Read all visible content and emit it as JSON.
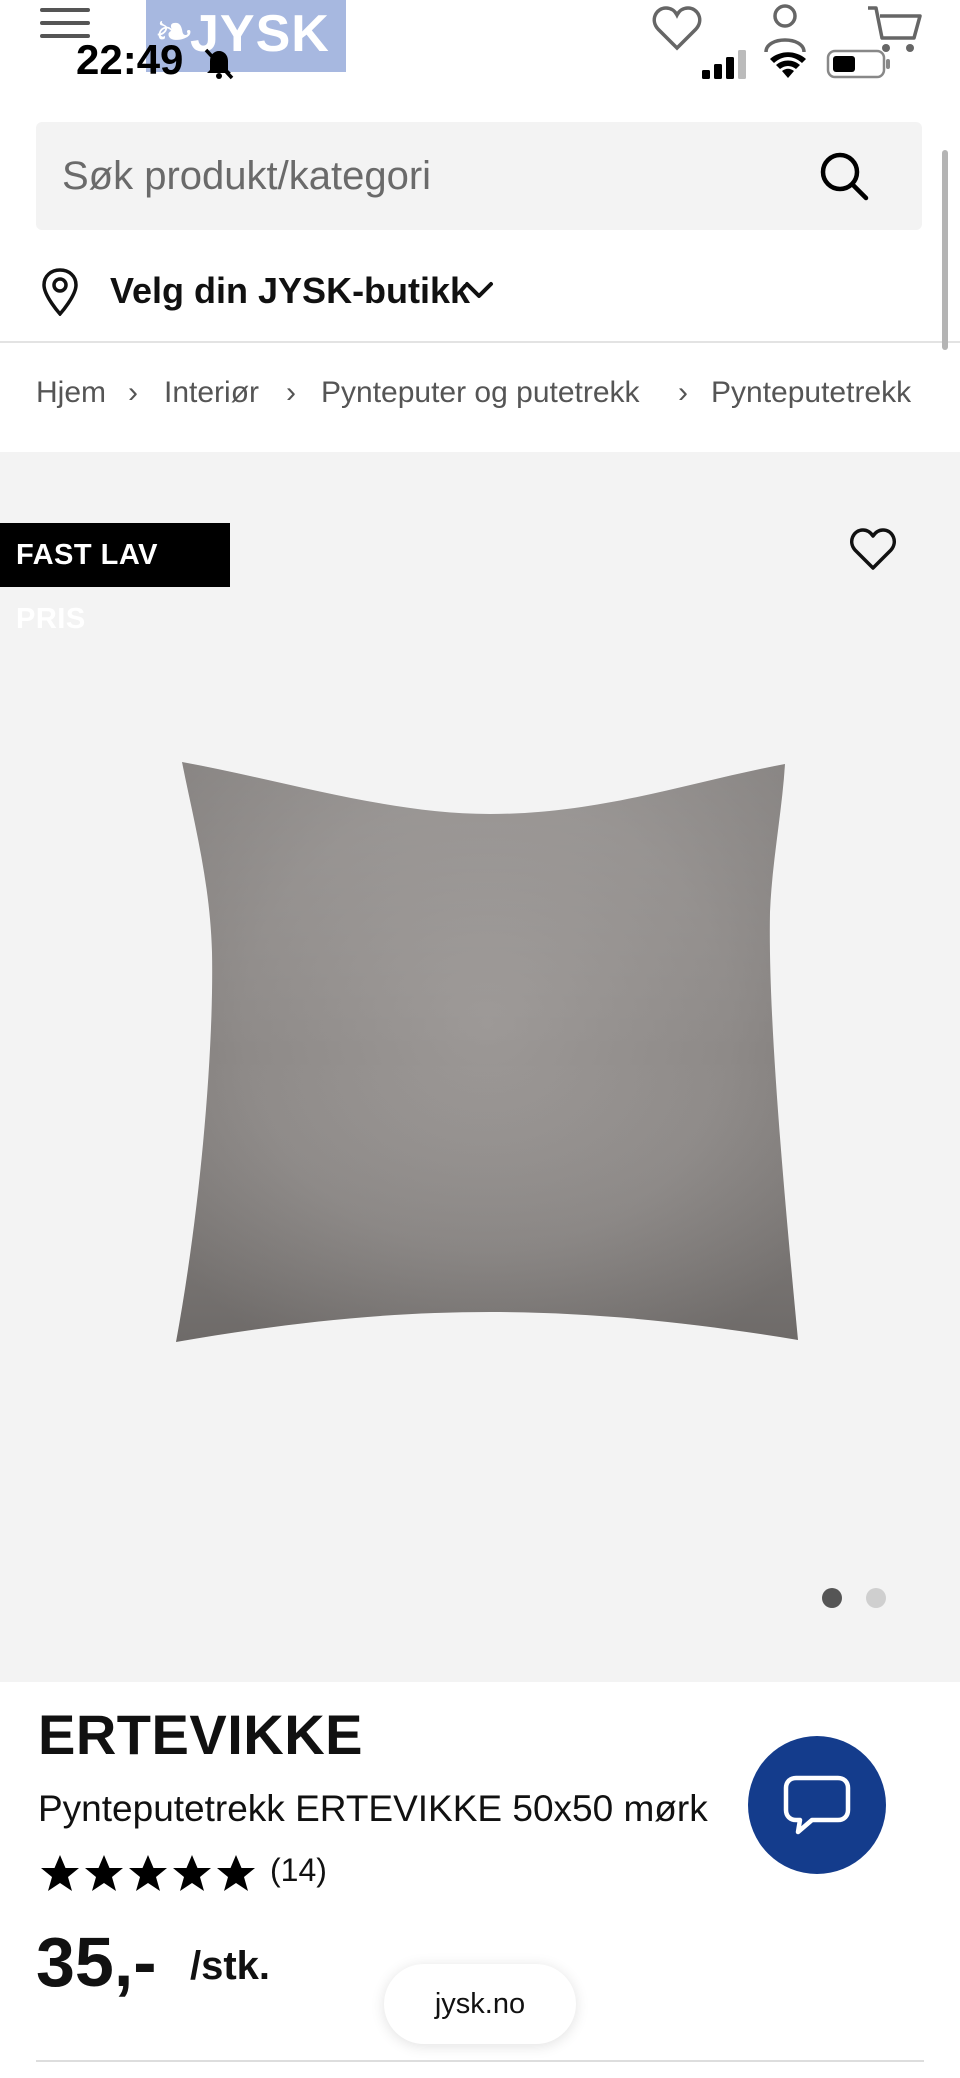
{
  "status_bar": {
    "time": "22:49"
  },
  "header": {
    "logo_text": "JYSK",
    "menu_icon": "hamburger-menu-icon",
    "icons": [
      "heart-icon",
      "user-icon",
      "cart-icon"
    ]
  },
  "search": {
    "placeholder": "Søk produkt/kategori"
  },
  "store": {
    "label": "Velg din JYSK-butikk"
  },
  "breadcrumb": {
    "items": [
      "Hjem",
      "Interiør",
      "Pynteputer og putetrekk",
      "Pynteputetrekk"
    ]
  },
  "gallery": {
    "badge": "FAST LAV PRIS",
    "image_count": 2,
    "active_index": 0
  },
  "product": {
    "brand": "ERTEVIKKE",
    "title": "Pynteputetrekk ERTEVIKKE 50x50 mørk",
    "rating_stars": 5,
    "rating_count": "(14)",
    "price": "35,-",
    "unit": "/stk."
  },
  "browser": {
    "url": "jysk.no"
  },
  "colors": {
    "brand_blue": "#143c8c",
    "badge_bg": "#000000",
    "gallery_bg": "#f3f3f3"
  }
}
